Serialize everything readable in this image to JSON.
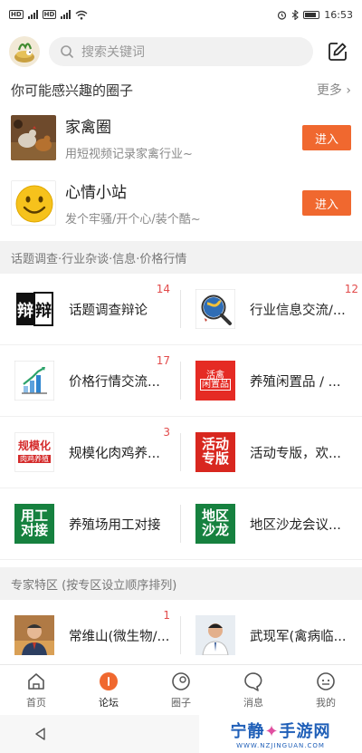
{
  "statusbar": {
    "time": "16:53"
  },
  "search": {
    "placeholder": "搜索关键词"
  },
  "recommend": {
    "title": "你可能感兴趣的圈子",
    "more": "更多",
    "circles": [
      {
        "name": "家禽圈",
        "desc": "用短视频记录家禽行业~",
        "button": "进入"
      },
      {
        "name": "心情小站",
        "desc": "发个牢骚/开个心/装个酷~",
        "button": "进入"
      }
    ]
  },
  "topics": {
    "band": "话题调查·行业杂谈·信息·价格行情",
    "items": [
      {
        "label": "话题调查辩论",
        "badge": "14",
        "icon": "debate-icon"
      },
      {
        "label": "行业信息交流/...",
        "badge": "12",
        "icon": "globe-search-icon"
      },
      {
        "label": "价格行情交流...",
        "badge": "17",
        "icon": "bar-chart-icon"
      },
      {
        "label": "养殖闲置品 / ...",
        "badge": "",
        "icon": "idle-goods-icon",
        "tile": "活禽\n闲置品"
      },
      {
        "label": "规模化肉鸡养...",
        "badge": "3",
        "icon": "broiler-icon",
        "tile": "规模化\n肉鸡养殖"
      },
      {
        "label": "活动专版，欢...",
        "badge": "",
        "icon": "activity-icon",
        "tile": "活动\n专版"
      },
      {
        "label": "养殖场用工对接",
        "badge": "",
        "icon": "recruit-icon",
        "tile": "用工\n对接"
      },
      {
        "label": "地区沙龙会议...",
        "badge": "",
        "icon": "salon-icon",
        "tile": "地区\n沙龙"
      }
    ]
  },
  "experts": {
    "band": "专家特区 (按专区设立顺序排列)",
    "items": [
      {
        "label": "常维山(微生物/...",
        "badge": "1"
      },
      {
        "label": "武现军(禽病临...",
        "badge": ""
      }
    ]
  },
  "tabs": [
    {
      "label": "首页",
      "icon": "home-icon"
    },
    {
      "label": "论坛",
      "icon": "forum-icon",
      "active": true
    },
    {
      "label": "圈子",
      "icon": "circle-icon"
    },
    {
      "label": "消息",
      "icon": "message-icon"
    },
    {
      "label": "我的",
      "icon": "profile-icon"
    }
  ],
  "watermark": {
    "title": "宁静",
    "title2": "手游网",
    "sub": "WWW.NZJINGUAN.COM"
  },
  "colors": {
    "accent": "#f0682f",
    "badge": "#e24b4b",
    "band": "#f2f2f2"
  }
}
